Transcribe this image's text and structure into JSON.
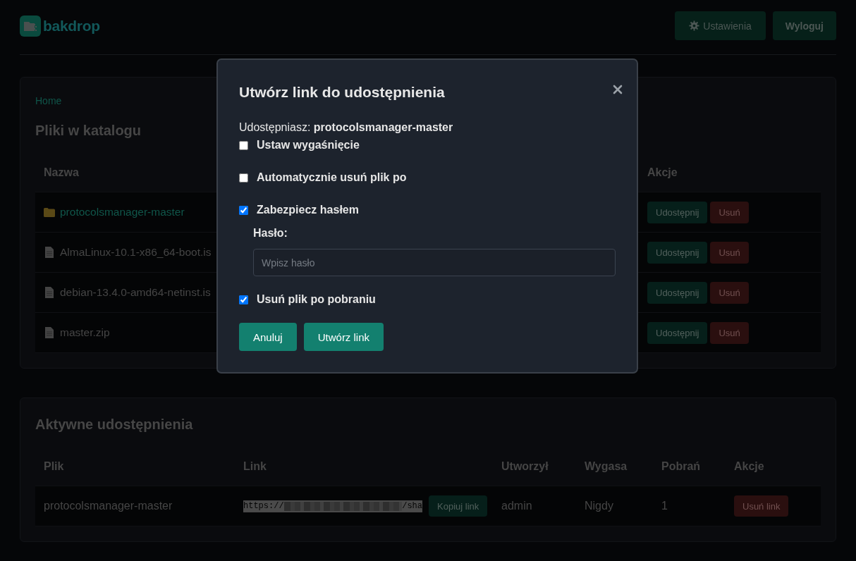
{
  "header": {
    "logo": "bakdrop",
    "buttons": [
      {
        "label": "Ustawienia",
        "kind": "settings"
      },
      {
        "label": "Wyloguj",
        "kind": "logout"
      }
    ]
  },
  "files_panel": {
    "breadcrumb": [
      "Home"
    ],
    "title": "Pliki w katalogu",
    "columns": [
      "Nazwa",
      "Akcje"
    ],
    "rows": [
      {
        "kind": "folder",
        "name": "protocolsmanager-master",
        "share_button": "Udostępnij",
        "delete_button": "Usuń"
      },
      {
        "kind": "file",
        "name": "AlmaLinux-10.1-x86_64-boot.is",
        "share_button": "Udostępnij",
        "delete_button": "Usuń"
      },
      {
        "kind": "file",
        "name": "debian-13.4.0-amd64-netinst.is",
        "share_button": "Udostępnij",
        "delete_button": "Usuń"
      },
      {
        "kind": "file",
        "name": "master.zip",
        "share_button": "Udostępnij",
        "delete_button": "Usuń"
      }
    ]
  },
  "shares_panel": {
    "title": "Aktywne udostępnienia",
    "columns": [
      "Plik",
      "Link",
      "Utworzył",
      "Wygasa",
      "Pobrań",
      "Akcje"
    ],
    "rows": [
      {
        "file": "protocolsmanager-master",
        "link_start": "https://",
        "link_end": "/sha",
        "copy_button": "Kopiuj link",
        "created_by": "admin",
        "expires": "Nigdy",
        "downloads": "1",
        "delete_button": "Usuń link"
      }
    ]
  },
  "dialog": {
    "title": "Utwórz link do udostępnienia",
    "sharing_text": "Udostępniasz: **protocolsmanager-master**",
    "options": [
      {
        "label": "Ustaw wygaśnięcie",
        "checked": false
      },
      {
        "label": "Automatycznie usuń plik po",
        "checked": false
      },
      {
        "label": "Zabezpiecz hasłem",
        "checked": true,
        "password": {
          "label": "Hasło:",
          "placeholder": "Wpisz hasło"
        }
      },
      {
        "label": "Usuń plik po pobraniu",
        "checked": true
      }
    ],
    "buttons": [
      "Anuluj",
      "Utwórz link"
    ]
  }
}
